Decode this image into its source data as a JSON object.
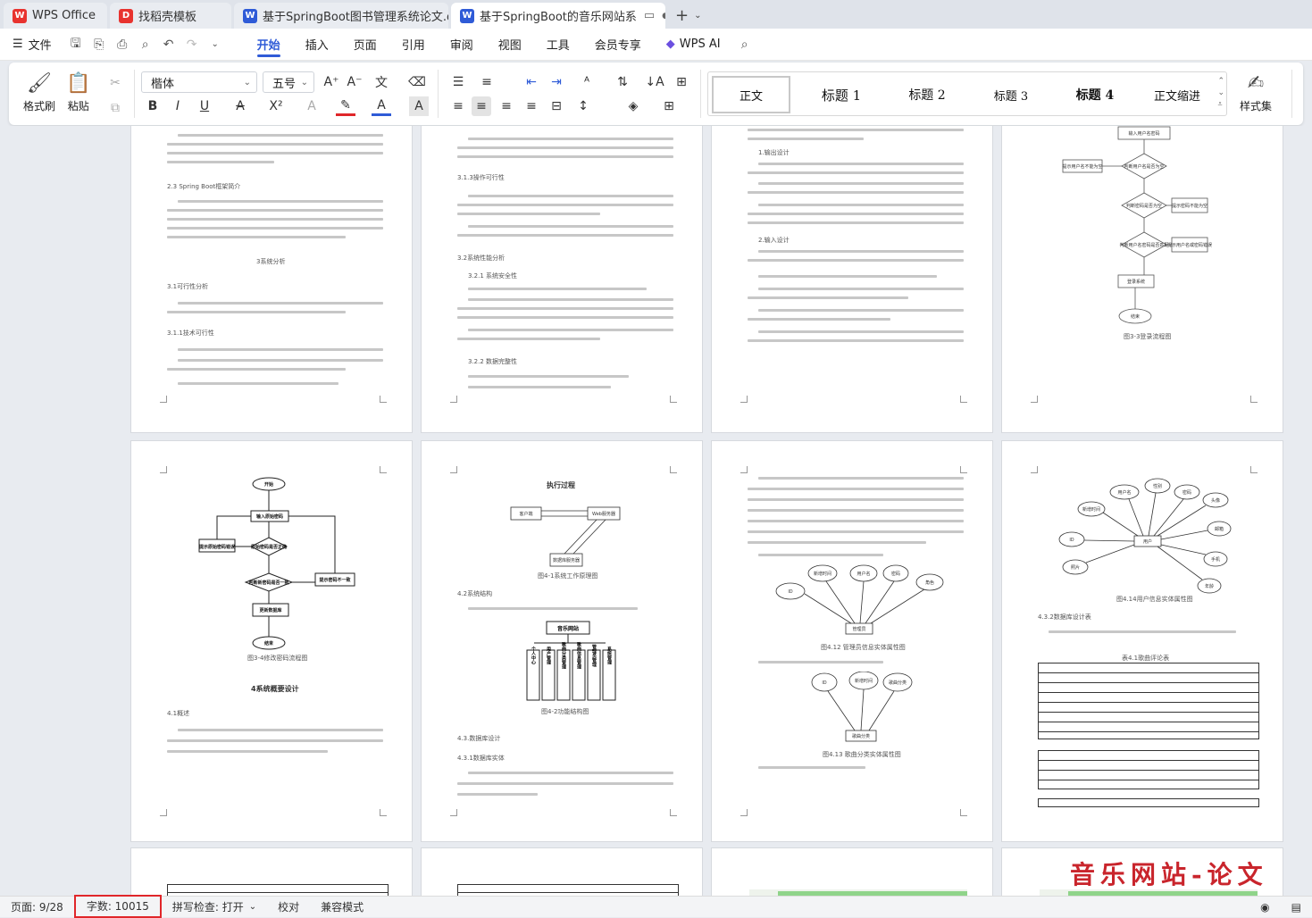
{
  "tabs": [
    {
      "label": "WPS Office",
      "icon": "wps-logo-icon",
      "color": "#e8332f"
    },
    {
      "label": "找稻壳模板",
      "icon": "docer-icon",
      "color": "#e8332f"
    },
    {
      "label": "基于SpringBoot图书管理系统论文.d",
      "icon": "writer-icon",
      "color": "#2f5bd7"
    },
    {
      "label": "基于SpringBoot的音乐网站系",
      "icon": "writer-icon",
      "color": "#2f5bd7"
    }
  ],
  "menu": {
    "file": "文件",
    "items": [
      "开始",
      "插入",
      "页面",
      "引用",
      "审阅",
      "视图",
      "工具",
      "会员专享"
    ],
    "ai": "WPS AI"
  },
  "ribbon": {
    "format_painter": "格式刷",
    "paste": "粘贴",
    "font_name": "楷体",
    "font_size": "五号",
    "styles": [
      "正文",
      "标题 1",
      "标题 2",
      "标题 3",
      "标题 4",
      "正文缩进"
    ],
    "style_set": "样式集"
  },
  "document": {
    "page1": {
      "h_springboot": "2.3 Spring Boot框架简介",
      "h_chapter3": "3系统分析",
      "h_31": "3.1可行性分析",
      "h_311": "3.1.1技术可行性"
    },
    "page2": {
      "h_313": "3.1.3操作可行性",
      "h_32": "3.2系统性能分析",
      "h_321": "3.2.1 系统安全性",
      "h_322": "3.2.2 数据完整性"
    },
    "page3": {
      "h_output": "1.输出设计",
      "h_input": "2.输入设计"
    },
    "page4": {
      "caption": "图3-3登录流程图",
      "flow": [
        "输入用户名密码",
        "判断用户名是否为空",
        "提示用户名不能为空",
        "判断密码是否为空",
        "提示密码不能为空",
        "判断用户名密码是否匹配",
        "提示用户名或密码错误",
        "登录系统",
        "结束"
      ]
    },
    "page5": {
      "caption": "图3-4修改密码流程图",
      "h_chapter4": "4系统概要设计",
      "h_41": "4.1概述",
      "flow": [
        "开始",
        "输入原始密码",
        "提示原始密码错误",
        "原始密码是否正确",
        "判断新密码是否一致",
        "提示密码不一致",
        "更新数据库",
        "结束"
      ]
    },
    "page6": {
      "title": "执行过程",
      "nodes": [
        "客户端",
        "Web服务器",
        "数据库服务器"
      ],
      "caption1": "图4-1系统工作原理图",
      "h_42": "4.2系统结构",
      "root": "音乐网站",
      "modules": [
        "个人中心",
        "用户管理",
        "歌曲分类管理",
        "歌曲信息管理",
        "管理员管理",
        "系统管理"
      ],
      "caption2": "图4-2功能结构图",
      "h_43": "4.3.数据库设计",
      "h_431": "4.3.1数据库实体"
    },
    "page7": {
      "entity1": "管理员",
      "attrs1": [
        "ID",
        "新增时间",
        "用户名",
        "密码",
        "角色"
      ],
      "caption1": "图4.12 管理员信息实体属性图",
      "entity2": "歌曲分类",
      "attrs2": [
        "ID",
        "新增时间",
        "歌曲分类"
      ],
      "caption2": "图4.13 歌曲分类实体属性图"
    },
    "page8": {
      "entity": "用户",
      "attrs": [
        "新增时间",
        "用户名",
        "性别",
        "密码",
        "头像",
        "邮箱",
        "手机",
        "年龄",
        "ID",
        "照片"
      ],
      "caption": "图4.14用户信息实体属性图",
      "h_432": "4.3.2数据库设计表",
      "table_caption": "表4.1歌曲评论表"
    }
  },
  "status": {
    "page": "页面: 9/28",
    "words": "字数: 10015",
    "spell": "拼写检查: 打开",
    "proof": "校对",
    "compat": "兼容模式"
  },
  "watermark": "音乐网站-论文"
}
